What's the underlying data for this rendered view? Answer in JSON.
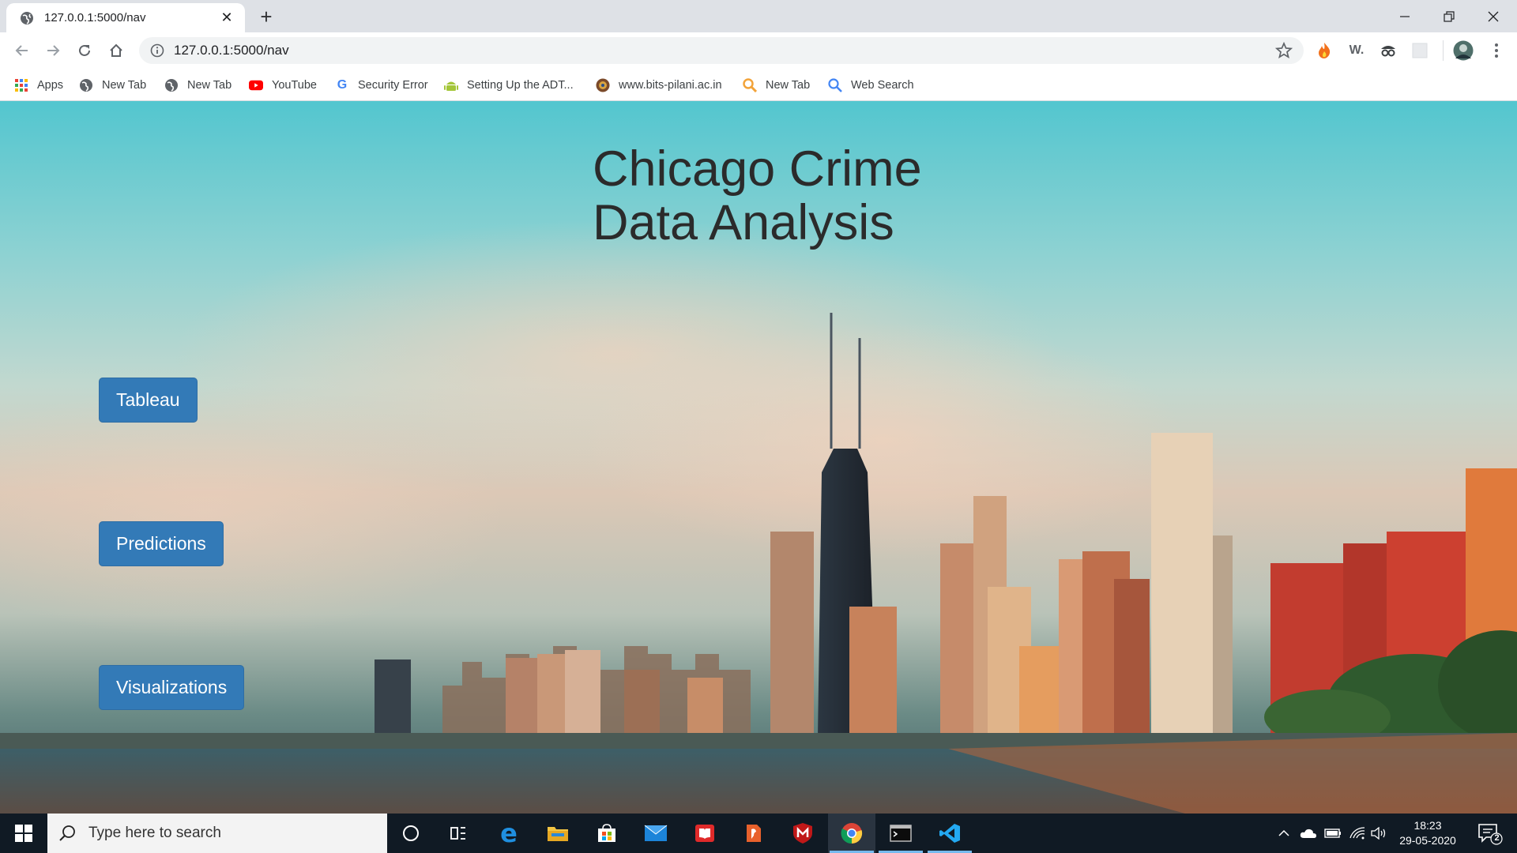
{
  "tab": {
    "title": "127.0.0.1:5000/nav",
    "close": "✕"
  },
  "window": {
    "new_tab": "+",
    "minimize": "─",
    "maximize": "❐",
    "close": "✕"
  },
  "toolbar": {
    "url": "127.0.0.1:5000/nav"
  },
  "extensions": [
    {
      "name": "flame-extension-icon"
    },
    {
      "name": "w-extension",
      "label": "W."
    },
    {
      "name": "spy-extension-icon"
    },
    {
      "name": "puzzle-extension-icon"
    },
    {
      "name": "profile-avatar"
    }
  ],
  "bookmarks": [
    {
      "label": "Apps",
      "icon": "apps-grid-icon"
    },
    {
      "label": "New Tab",
      "icon": "globe-icon"
    },
    {
      "label": "New Tab",
      "icon": "globe-icon"
    },
    {
      "label": "YouTube",
      "icon": "youtube-icon"
    },
    {
      "label": "Security Error",
      "icon": "google-icon"
    },
    {
      "label": "Setting Up the ADT...",
      "icon": "android-icon"
    },
    {
      "label": "www.bits-pilani.ac.in",
      "icon": "bits-logo-icon"
    },
    {
      "label": "New Tab",
      "icon": "magnifier-icon"
    },
    {
      "label": "Web Search",
      "icon": "search-icon"
    }
  ],
  "page": {
    "heading_line1": "Chicago Crime",
    "heading_line2": "Data Analysis",
    "buttons": [
      "Tableau",
      "Predictions",
      "Visualizations"
    ]
  },
  "taskbar": {
    "search_placeholder": "Type here to search",
    "apps": [
      "cortana-icon",
      "task-view-icon",
      "edge-icon",
      "file-explorer-icon",
      "store-icon",
      "mail-icon",
      "red-app-icon",
      "orange-app-icon",
      "mcafee-icon",
      "chrome-icon",
      "terminal-icon",
      "vscode-icon"
    ],
    "time": "18:23",
    "date": "29-05-2020",
    "notification_count": "2"
  },
  "colors": {
    "button": "#337ab7",
    "taskbar": "#101a24",
    "tabstrip": "#dee1e6"
  }
}
